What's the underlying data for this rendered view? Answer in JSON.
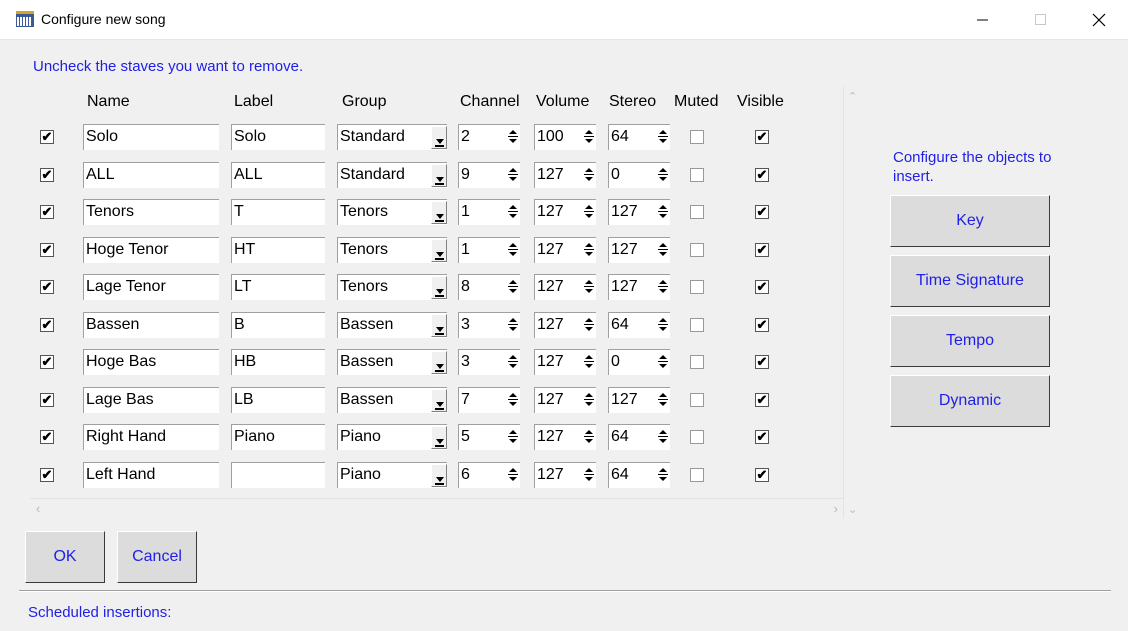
{
  "window": {
    "title": "Configure new song"
  },
  "instruction": "Uncheck the staves you want to remove.",
  "columns": {
    "name": "Name",
    "label": "Label",
    "group": "Group",
    "channel": "Channel",
    "volume": "Volume",
    "stereo": "Stereo",
    "muted": "Muted",
    "visible": "Visible"
  },
  "staves": [
    {
      "include": true,
      "name": "Solo",
      "label": "Solo",
      "group": "Standard",
      "channel": "2",
      "volume": "100",
      "stereo": "64",
      "muted": false,
      "visible": true
    },
    {
      "include": true,
      "name": "ALL",
      "label": "ALL",
      "group": "Standard",
      "channel": "9",
      "volume": "127",
      "stereo": "0",
      "muted": false,
      "visible": true
    },
    {
      "include": true,
      "name": "Tenors",
      "label": "T",
      "group": "Tenors",
      "channel": "1",
      "volume": "127",
      "stereo": "127",
      "muted": false,
      "visible": true
    },
    {
      "include": true,
      "name": "Hoge Tenor",
      "label": "HT",
      "group": "Tenors",
      "channel": "1",
      "volume": "127",
      "stereo": "127",
      "muted": false,
      "visible": true
    },
    {
      "include": true,
      "name": "Lage Tenor",
      "label": "LT",
      "group": "Tenors",
      "channel": "8",
      "volume": "127",
      "stereo": "127",
      "muted": false,
      "visible": true
    },
    {
      "include": true,
      "name": "Bassen",
      "label": "B",
      "group": "Bassen",
      "channel": "3",
      "volume": "127",
      "stereo": "64",
      "muted": false,
      "visible": true
    },
    {
      "include": true,
      "name": "Hoge Bas",
      "label": "HB",
      "group": "Bassen",
      "channel": "3",
      "volume": "127",
      "stereo": "0",
      "muted": false,
      "visible": true
    },
    {
      "include": true,
      "name": "Lage Bas",
      "label": "LB",
      "group": "Bassen",
      "channel": "7",
      "volume": "127",
      "stereo": "127",
      "muted": false,
      "visible": true
    },
    {
      "include": true,
      "name": "Right Hand",
      "label": "Piano",
      "group": "Piano",
      "channel": "5",
      "volume": "127",
      "stereo": "64",
      "muted": false,
      "visible": true
    },
    {
      "include": true,
      "name": "Left Hand",
      "label": "",
      "group": "Piano",
      "channel": "6",
      "volume": "127",
      "stereo": "64",
      "muted": false,
      "visible": true
    }
  ],
  "objects_panel": {
    "caption": "Configure the objects to insert.",
    "buttons": [
      "Key",
      "Time Signature",
      "Tempo",
      "Dynamic"
    ]
  },
  "footer": {
    "ok_label": "OK",
    "cancel_label": "Cancel",
    "scheduled_label": "Scheduled insertions:"
  },
  "colors": {
    "accent_text": "#1f1fe6",
    "background": "#f0f0f0"
  }
}
